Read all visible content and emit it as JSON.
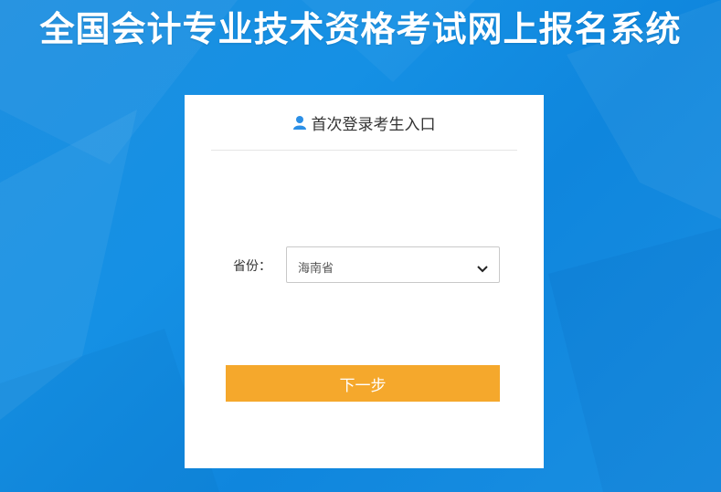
{
  "header": {
    "title": "全国会计专业技术资格考试网上报名系统"
  },
  "card": {
    "heading": "首次登录考生入口",
    "heading_icon": "user-icon",
    "province_label": "省份：",
    "province_value": "海南省",
    "dropdown_icon": "chevron-down-icon",
    "next_label": "下一步"
  },
  "colors": {
    "background": "#1590e4",
    "button": "#f5a82c",
    "icon": "#2b8fe6"
  }
}
